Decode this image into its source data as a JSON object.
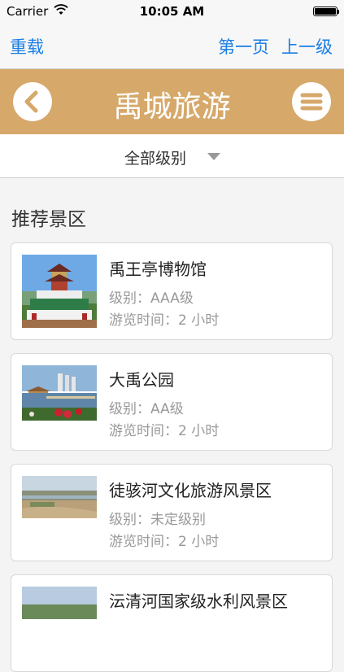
{
  "status_bar": {
    "carrier": "Carrier",
    "time": "10:05 AM"
  },
  "topnav": {
    "reload": "重载",
    "first_page": "第一页",
    "up_level": "上一级"
  },
  "header": {
    "title": "禹城旅游"
  },
  "filter": {
    "label": "全部级别"
  },
  "section": {
    "title": "推荐景区"
  },
  "spots": [
    {
      "name": "禹王亭博物馆",
      "level": "级别：AAA级",
      "duration": "游览时间：2 小时"
    },
    {
      "name": "大禹公园",
      "level": "级别：AA级",
      "duration": "游览时间：2 小时"
    },
    {
      "name": "徒骇河文化旅游风景区",
      "level": "级别：未定级别",
      "duration": "游览时间：2 小时"
    },
    {
      "name": "沄清河国家级水利风景区"
    }
  ],
  "colors": {
    "accent_blue": "#1a7ee6",
    "header_tan": "#d6a86a"
  }
}
